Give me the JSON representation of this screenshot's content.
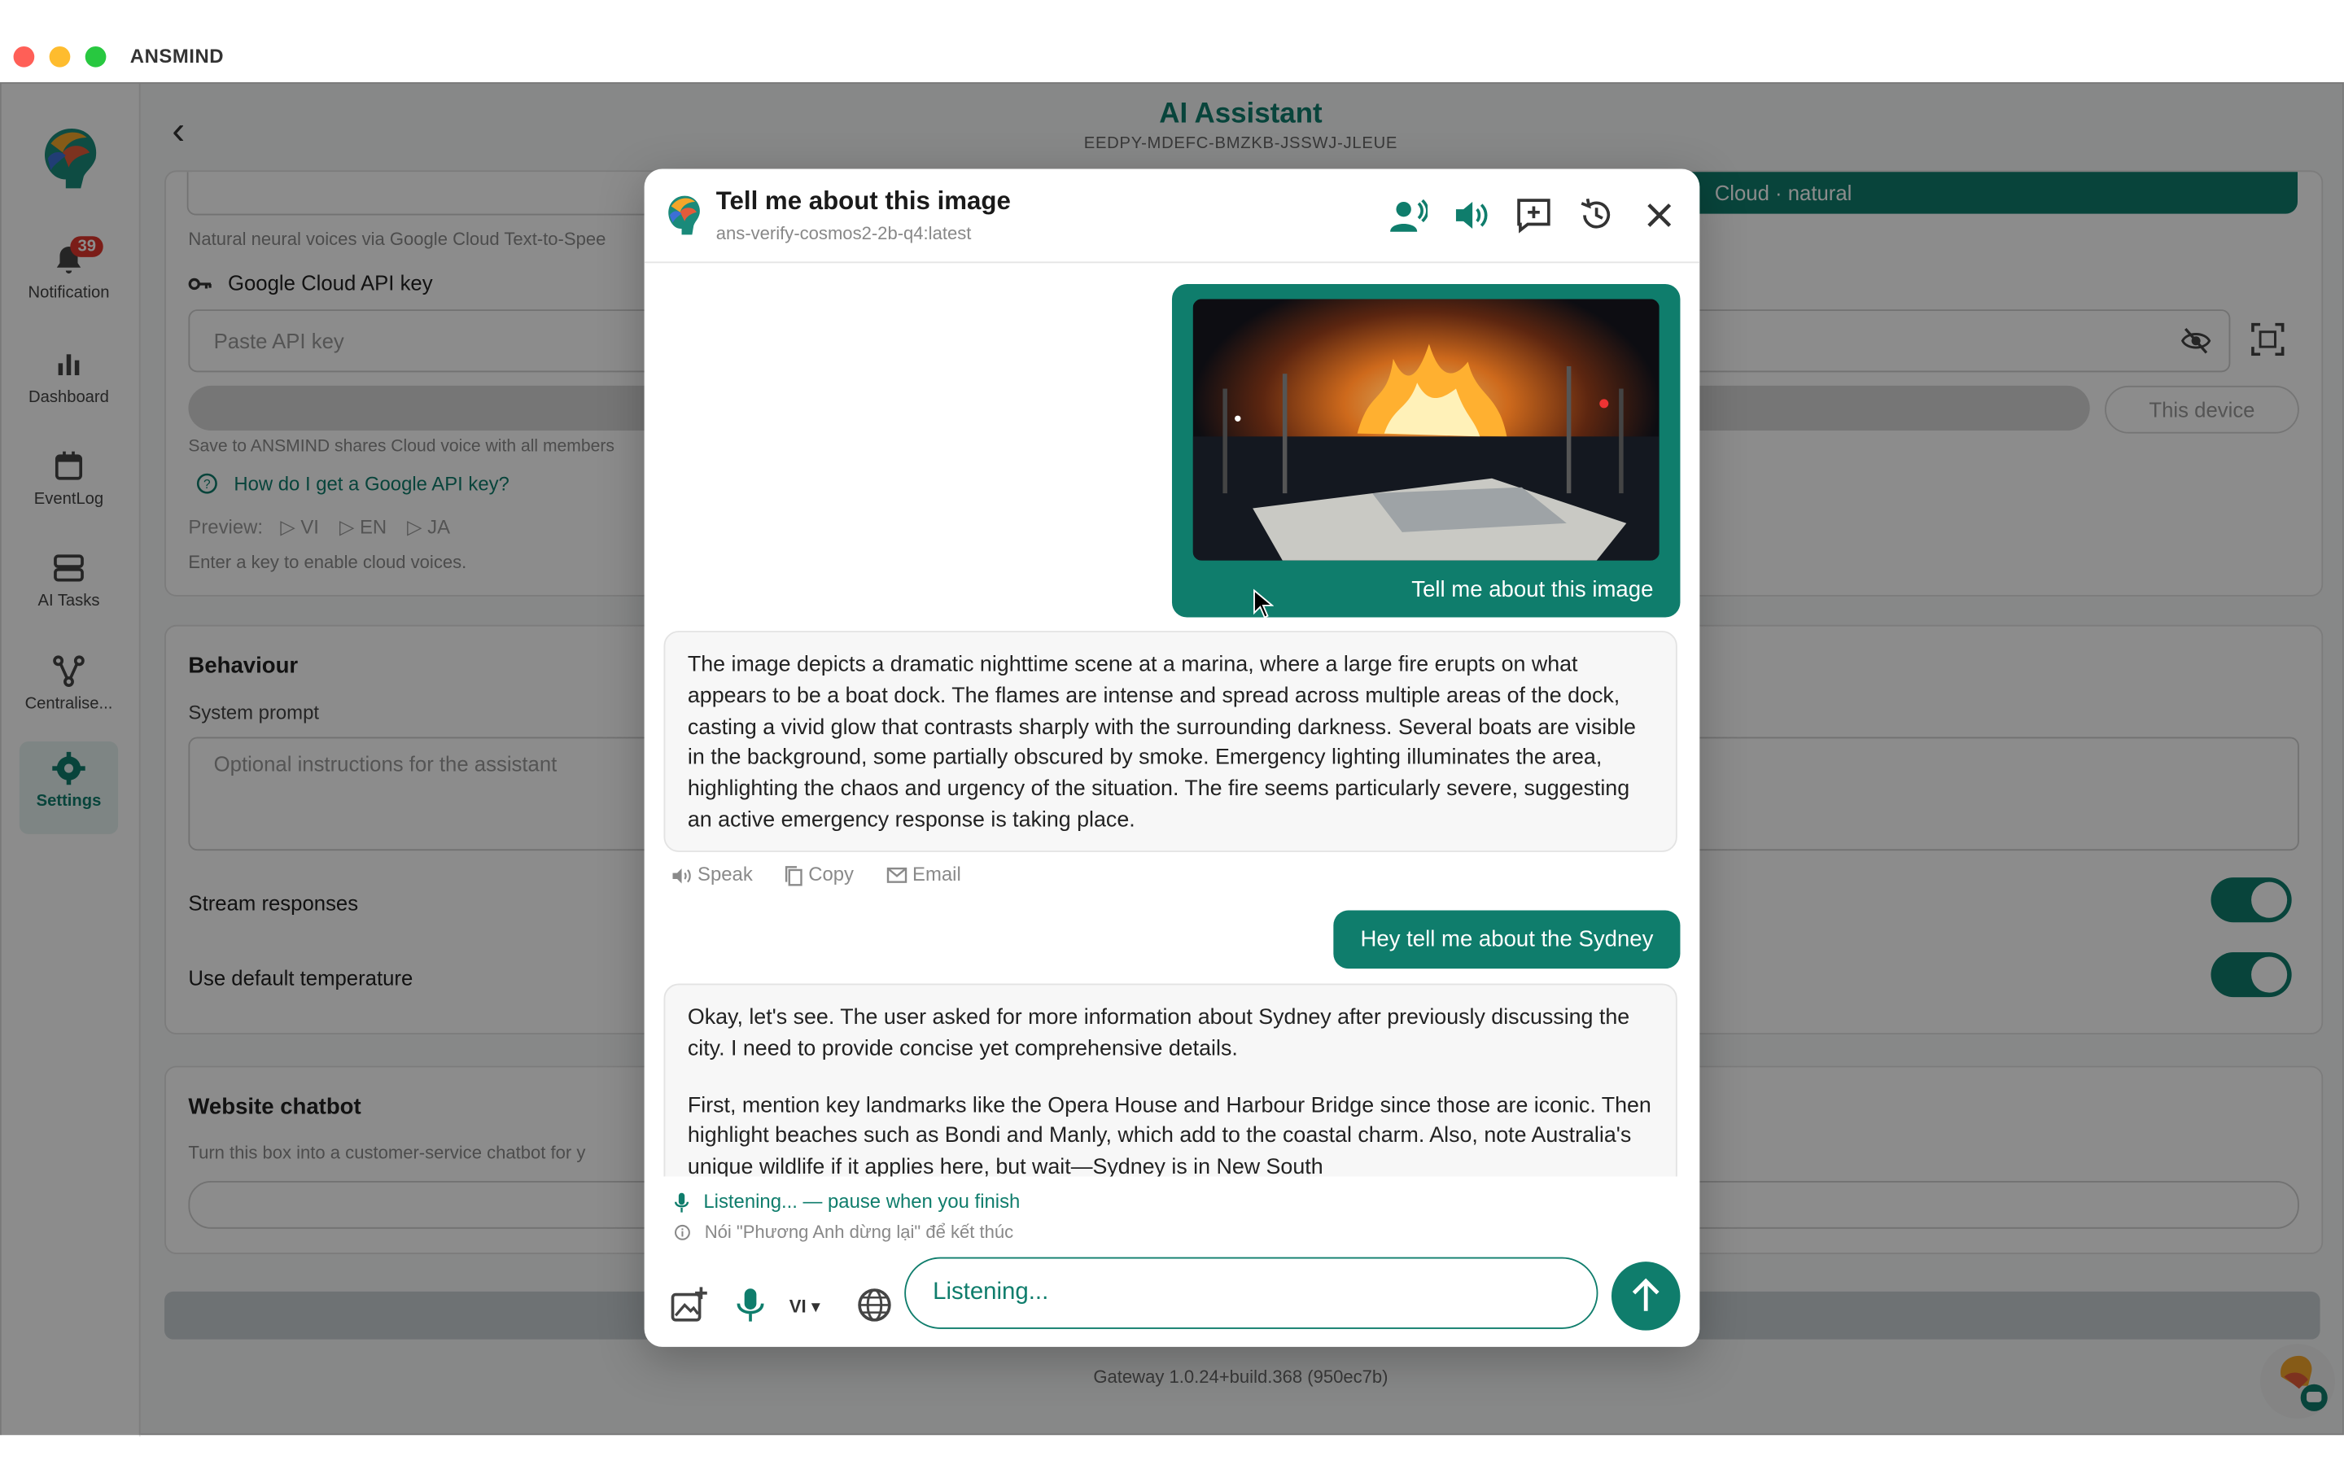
{
  "window": {
    "app_name": "ANSMIND"
  },
  "rail": {
    "items": [
      {
        "label": "Notification",
        "badge": "39"
      },
      {
        "label": "Dashboard"
      },
      {
        "label": "EventLog"
      },
      {
        "label": "AI Tasks"
      },
      {
        "label": "Centralise..."
      },
      {
        "label": "Settings"
      }
    ]
  },
  "header": {
    "title": "AI Assistant",
    "subtitle": "EEDPY-MDEFC-BMZKB-JSSWJ-JLEUE"
  },
  "voice": {
    "cloud_button": "Cloud · natural",
    "description": "Natural neural voices via Google Cloud Text-to-Spee",
    "api_key_label": "Google Cloud API key",
    "api_key_placeholder": "Paste API key",
    "this_device_button": "This device",
    "save_note": "Save to ANSMIND shares Cloud voice with all members",
    "help_link": "How do I get a Google API key?",
    "preview_label": "Preview:",
    "preview_langs": [
      "VI",
      "EN",
      "JA"
    ],
    "enable_note": "Enter a key to enable cloud voices."
  },
  "behaviour": {
    "heading": "Behaviour",
    "system_prompt_label": "System prompt",
    "system_prompt_placeholder": "Optional instructions for the assistant",
    "stream_label": "Stream responses",
    "stream_on": true,
    "temperature_label": "Use default temperature",
    "temperature_on": true
  },
  "website_chatbot": {
    "heading": "Website chatbot",
    "description": "Turn this box into a customer-service chatbot for y"
  },
  "footer": {
    "build": "Gateway 1.0.24+build.368 (950ec7b)"
  },
  "chat": {
    "title": "Tell me about this image",
    "model": "ans-verify-cosmos2-2b-q4:latest",
    "header_icons": [
      "voice-conversation-icon",
      "speaker-icon",
      "new-chat-icon",
      "history-icon",
      "close-icon"
    ],
    "messages": {
      "user_image_caption": "Tell me about this image",
      "bot_reply_1": "The image depicts a dramatic nighttime scene at a marina, where a large fire erupts on what appears to be a boat dock. The flames are intense and spread across multiple areas of the dock, casting a vivid glow that contrasts sharply with the surrounding darkness. Several boats are visible in the background, some partially obscured by smoke. Emergency lighting illuminates the area, highlighting the chaos and urgency of the situation. The fire seems particularly severe, suggesting an active emergency response is taking place.",
      "actions": {
        "speak": "Speak",
        "copy": "Copy",
        "email": "Email"
      },
      "user_text": "Hey tell me about the Sydney",
      "bot_reply_2_p1": "Okay, let's see. The user asked for more information about Sydney after previously discussing the city. I need to provide concise yet comprehensive details.",
      "bot_reply_2_p2": "First, mention key landmarks like the Opera House and Harbour Bridge since those are iconic. Then highlight beaches such as Bondi and Manly, which add to the coastal charm. Also, note Australia's unique wildlife if it applies here, but wait—Sydney is in New South"
    },
    "status": {
      "listening": "Listening... — pause when you finish",
      "hint": "Nói \"Phương Anh dừng lại\" để kết thúc"
    },
    "composer": {
      "language": "VI",
      "input_placeholder": "Listening..."
    }
  },
  "colors": {
    "accent": "#0f7d6c",
    "badge": "#e0362c"
  }
}
